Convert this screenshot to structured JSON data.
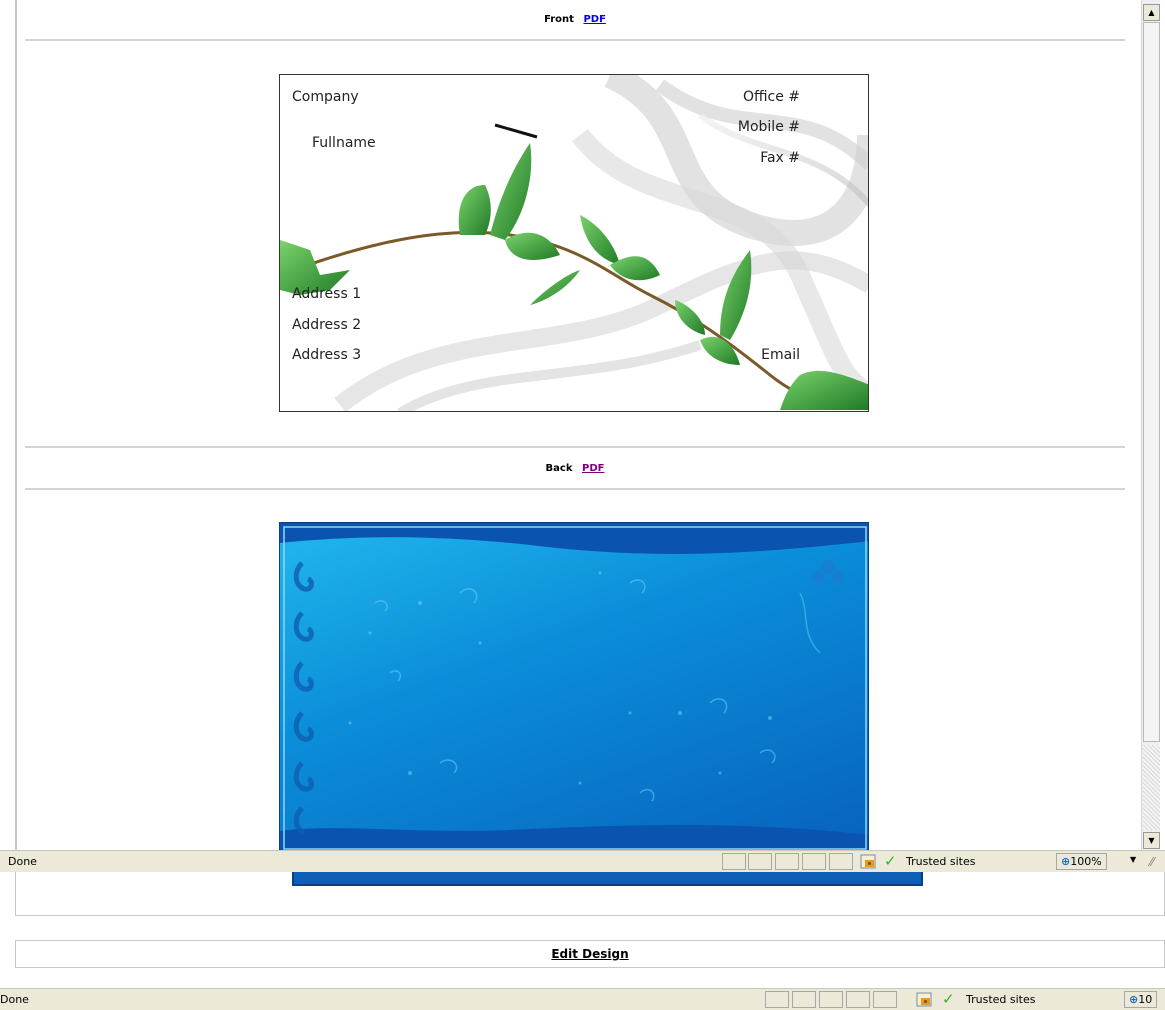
{
  "front": {
    "heading": "Front",
    "pdf_label": "PDF"
  },
  "back": {
    "heading": "Back",
    "pdf_label": "PDF"
  },
  "card": {
    "company": "Company",
    "fullname": "Fullname",
    "office": "Office #",
    "mobile": "Mobile #",
    "fax": "Fax #",
    "address1": "Address 1",
    "address2": "Address 2",
    "address3": "Address 3",
    "email": "Email"
  },
  "edit_design": "Edit Design",
  "statusbar_top": {
    "status": "Done",
    "zone": "Trusted sites",
    "zoom": "100%"
  },
  "statusbar_bottom": {
    "status": "Done",
    "zone": "Trusted sites",
    "zoom": "10"
  },
  "colors": {
    "link": "#0000ee",
    "visited": "#800080",
    "card_back_blue": "#0b8ed9"
  }
}
